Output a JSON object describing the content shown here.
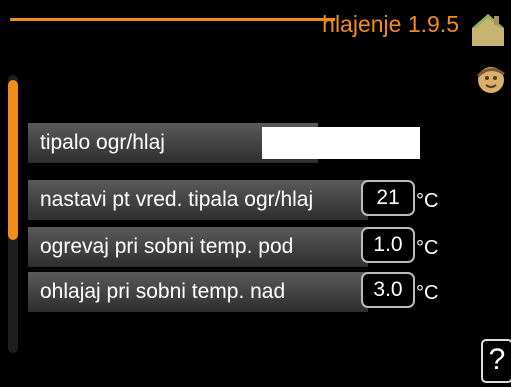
{
  "header": {
    "title": "hlajenje 1.9.5"
  },
  "menu": {
    "items": [
      {
        "label": "tipalo ogr/hlaj",
        "value": ""
      },
      {
        "label": "nastavi pt vred. tipala ogr/hlaj",
        "value": "21",
        "unit": "°C"
      },
      {
        "label": "ogrevaj pri sobni temp. pod",
        "value": "1.0",
        "unit": "°C"
      },
      {
        "label": "ohlajaj pri sobni temp. nad",
        "value": "3.0",
        "unit": "°C"
      }
    ]
  },
  "side": {
    "help_label": "?"
  },
  "icons": {
    "house": "house-icon",
    "child": "child-face-icon",
    "help": "help-icon"
  },
  "colors": {
    "accent": "#f28c1a",
    "background": "#000000"
  }
}
